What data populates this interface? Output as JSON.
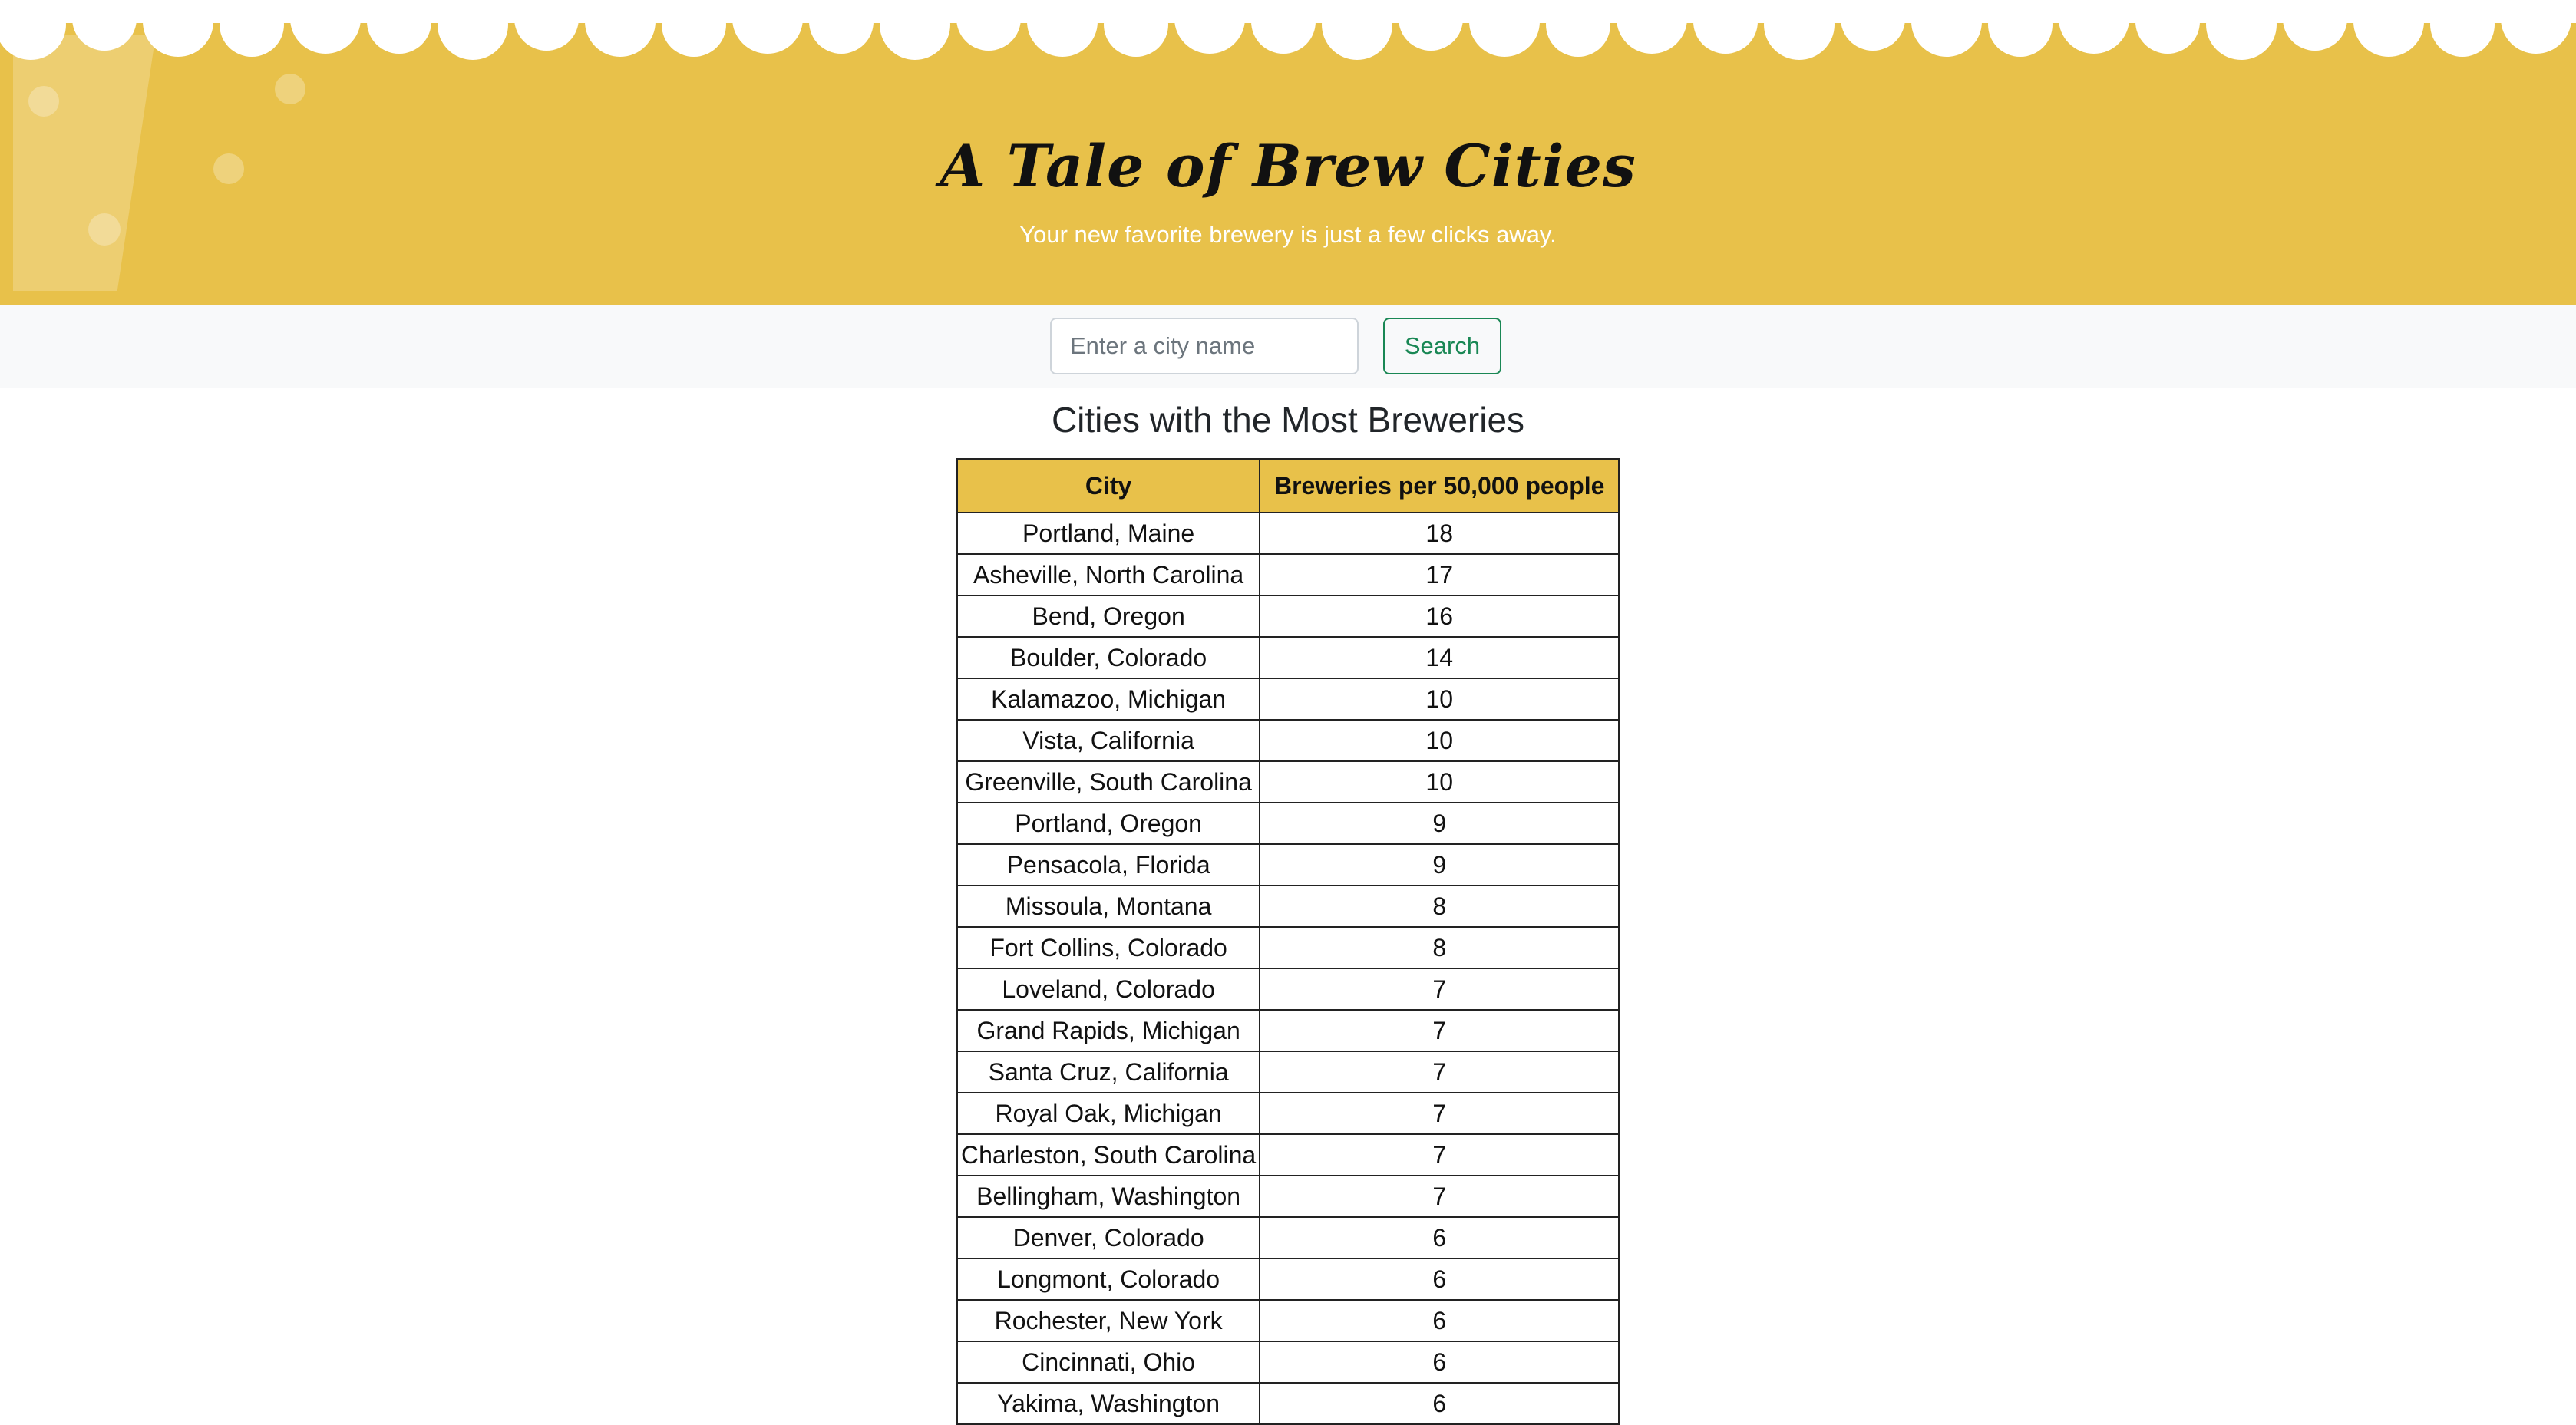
{
  "header": {
    "title": "A Tale of Brew Cities",
    "subtitle": "Your new favorite brewery is just a few clicks away.",
    "colors": {
      "beer": "#e8c14a",
      "foam": "#ffffff"
    }
  },
  "search": {
    "placeholder": "Enter a city name",
    "value": "",
    "button_label": "Search",
    "button_color": "#198754"
  },
  "table": {
    "title": "Cities with the Most Breweries",
    "columns": [
      "City",
      "Breweries per 50,000 people"
    ],
    "rows": [
      {
        "city": "Portland, Maine",
        "count": "18"
      },
      {
        "city": "Asheville, North Carolina",
        "count": "17"
      },
      {
        "city": "Bend, Oregon",
        "count": "16"
      },
      {
        "city": "Boulder, Colorado",
        "count": "14"
      },
      {
        "city": "Kalamazoo, Michigan",
        "count": "10"
      },
      {
        "city": "Vista, California",
        "count": "10"
      },
      {
        "city": "Greenville, South Carolina",
        "count": "10"
      },
      {
        "city": "Portland, Oregon",
        "count": "9"
      },
      {
        "city": "Pensacola, Florida",
        "count": "9"
      },
      {
        "city": "Missoula, Montana",
        "count": "8"
      },
      {
        "city": "Fort Collins, Colorado",
        "count": "8"
      },
      {
        "city": "Loveland, Colorado",
        "count": "7"
      },
      {
        "city": "Grand Rapids, Michigan",
        "count": "7"
      },
      {
        "city": "Santa Cruz, California",
        "count": "7"
      },
      {
        "city": "Royal Oak, Michigan",
        "count": "7"
      },
      {
        "city": "Charleston, South Carolina",
        "count": "7"
      },
      {
        "city": "Bellingham, Washington",
        "count": "7"
      },
      {
        "city": "Denver, Colorado",
        "count": "6"
      },
      {
        "city": "Longmont, Colorado",
        "count": "6"
      },
      {
        "city": "Rochester, New York",
        "count": "6"
      },
      {
        "city": "Cincinnati, Ohio",
        "count": "6"
      },
      {
        "city": "Yakima, Washington",
        "count": "6"
      }
    ]
  }
}
